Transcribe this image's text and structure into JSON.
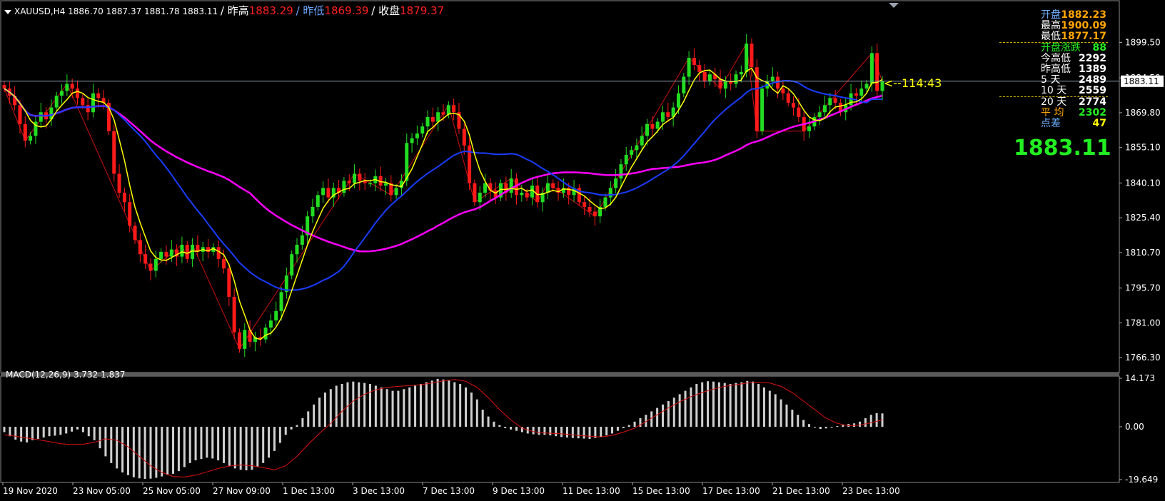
{
  "header": {
    "symbol": "XAUUSD,H4",
    "ohlc": "1886.70 1887.37 1881.78 1883.11",
    "label_high": "/ 昨高",
    "value_high": "1883.29",
    "label_low": "/ 昨低",
    "value_low": "1869.39",
    "label_close": "/ 收盘",
    "value_close": "1879.37"
  },
  "macd": {
    "label": "MACD(12,26,9) 3.732 1.837",
    "axis_labels": [
      "14.173",
      "0.00",
      "-19.649"
    ]
  },
  "price_axis": {
    "labels": [
      "1899.50",
      "1884.50",
      "1869.80",
      "1855.10",
      "1840.10",
      "1825.40",
      "1810.70",
      "1795.70",
      "1781.00",
      "1766.30"
    ],
    "current": "1883.11"
  },
  "time_axis": {
    "labels": [
      "19 Nov 2020",
      "23 Nov 05:00",
      "25 Nov 05:00",
      "27 Nov 09:00",
      "1 Dec 13:00",
      "3 Dec 13:00",
      "7 Dec 13:00",
      "9 Dec 13:00",
      "11 Dec 13:00",
      "15 Dec 13:00",
      "17 Dec 13:00",
      "21 Dec 13:00",
      "23 Dec 13:00"
    ]
  },
  "info_panel": {
    "rows": [
      {
        "k": "开盘",
        "v": "1882.23",
        "kc": "#6fb1ff",
        "vc": "#ffa500"
      },
      {
        "k": "最高",
        "v": "1900.09",
        "kc": "#ffffff",
        "vc": "#ffa500"
      },
      {
        "k": "最低",
        "v": "1877.17",
        "kc": "#ffffff",
        "vc": "#ffa500"
      },
      {
        "k": "开盘涨跌",
        "v": "88",
        "kc": "#22ee22",
        "vc": "#22ee22"
      },
      {
        "k": "今高低",
        "v": "2292",
        "kc": "#ffffff",
        "vc": "#ffffff"
      },
      {
        "k": "昨高低",
        "v": "1389",
        "kc": "#ffffff",
        "vc": "#ffffff"
      },
      {
        "k": "5  天",
        "v": "2489",
        "kc": "#ffffff",
        "vc": "#ffffff"
      },
      {
        "k": "10 天",
        "v": "2559",
        "kc": "#ffffff",
        "vc": "#ffffff"
      },
      {
        "k": "20 天",
        "v": "2774",
        "kc": "#ffffff",
        "vc": "#ffffff"
      },
      {
        "k": "平  均",
        "v": "2302",
        "kc": "#ffa500",
        "vc": "#22ee22"
      },
      {
        "k": "点差",
        "v": "47",
        "kc": "#6fb1ff",
        "vc": "#ffff00"
      }
    ],
    "big_price": "1883.11",
    "countdown": "<--114:43"
  },
  "colors": {
    "bull": "#22dd22",
    "bear": "#ff1a1a",
    "ma_fast": "#ffff00",
    "ma_mid": "#1a3cff",
    "ma_slow": "#ff00ff",
    "zigzag": "#cc1010",
    "grid": "#333333"
  },
  "chart_data": {
    "type": "candlestick",
    "title": "XAUUSD,H4",
    "ylim": [
      1760,
      1912
    ],
    "grid": false,
    "closes": [
      1880.0,
      1877.0,
      1873.0,
      1865.0,
      1858.0,
      1860.0,
      1866.0,
      1870.0,
      1867.0,
      1872.0,
      1877.0,
      1879.0,
      1882.0,
      1880.0,
      1876.0,
      1873.0,
      1870.0,
      1878.0,
      1876.0,
      1874.0,
      1862.0,
      1844.0,
      1836.0,
      1832.0,
      1822.0,
      1816.0,
      1810.0,
      1806.0,
      1803.0,
      1808.0,
      1811.0,
      1809.0,
      1812.0,
      1809.0,
      1814.0,
      1808.0,
      1814.0,
      1811.0,
      1813.0,
      1811.0,
      1813.0,
      1808.0,
      1804.0,
      1792.0,
      1777.0,
      1770.0,
      1778.0,
      1773.0,
      1775.0,
      1774.0,
      1779.0,
      1782.0,
      1786.0,
      1794.0,
      1801.0,
      1810.0,
      1814.0,
      1818.0,
      1826.0,
      1830.0,
      1835.0,
      1838.0,
      1834.0,
      1838.0,
      1836.0,
      1841.0,
      1840.0,
      1844.0,
      1841.0,
      1840.0,
      1840.0,
      1843.0,
      1839.0,
      1840.0,
      1835.0,
      1838.0,
      1841.0,
      1857.0,
      1859.0,
      1861.0,
      1864.0,
      1868.0,
      1866.0,
      1870.0,
      1869.0,
      1873.0,
      1870.0,
      1863.0,
      1856.0,
      1840.0,
      1832.0,
      1836.0,
      1840.0,
      1837.0,
      1834.0,
      1840.0,
      1836.0,
      1842.0,
      1835.0,
      1836.0,
      1834.0,
      1839.0,
      1832.0,
      1836.0,
      1840.0,
      1838.0,
      1836.0,
      1838.0,
      1835.0,
      1838.0,
      1832.0,
      1830.0,
      1828.0,
      1826.0,
      1830.0,
      1834.0,
      1838.0,
      1842.0,
      1848.0,
      1852.0,
      1854.0,
      1856.0,
      1860.0,
      1865.0,
      1863.0,
      1866.0,
      1870.0,
      1868.0,
      1872.0,
      1878.0,
      1885.0,
      1893.0,
      1890.0,
      1887.0,
      1883.0,
      1886.0,
      1884.0,
      1880.0,
      1883.0,
      1882.0,
      1886.0,
      1887.0,
      1899.0,
      1889.0,
      1862.0,
      1880.0,
      1883.0,
      1885.0,
      1880.0,
      1878.0,
      1874.0,
      1872.0,
      1868.0,
      1862.0,
      1864.0,
      1868.0,
      1870.0,
      1873.0,
      1876.0,
      1874.0,
      1870.0,
      1873.0,
      1878.0,
      1877.0,
      1880.0,
      1882.0,
      1895.0,
      1879.0,
      1883.11
    ],
    "series": [
      {
        "name": "MACD histogram",
        "values": [
          -2.0,
          -3.5,
          -4.8,
          -5.5,
          -5.8,
          -5.0,
          -4.5,
          -4.0,
          -3.5,
          -3.3,
          -3.0,
          -2.5,
          -1.8,
          -1.0,
          -2.0,
          -3.5,
          -5.0,
          -8.0,
          -11.0,
          -13.5,
          -15.5,
          -17.0,
          -18.0,
          -18.8,
          -19.2,
          -19.4,
          -19.3,
          -19.0,
          -18.5,
          -18.0,
          -17.5,
          -16.5,
          -15.0,
          -13.5,
          -12.5,
          -12.0,
          -11.5,
          -11.8,
          -12.5,
          -13.5,
          -14.5,
          -15.5,
          -16.0,
          -16.2,
          -16.0,
          -15.0,
          -13.5,
          -11.5,
          -9.0,
          -6.0,
          -3.0,
          -1.0,
          0.5,
          2.5,
          4.5,
          6.5,
          8.5,
          10.0,
          11.0,
          12.0,
          12.5,
          13.0,
          13.2,
          13.0,
          12.8,
          12.5,
          12.0,
          11.5,
          11.0,
          10.5,
          10.5,
          11.0,
          11.5,
          12.0,
          12.5,
          13.0,
          13.5,
          14.0,
          13.8,
          13.5,
          13.0,
          12.5,
          11.5,
          10.0,
          8.0,
          5.0,
          3.0,
          1.5,
          0.5,
          -0.5,
          -1.0,
          -1.5,
          -2.0,
          -2.5,
          -2.8,
          -3.0,
          -3.0,
          -3.2,
          -3.5,
          -3.8,
          -4.0,
          -4.2,
          -4.3,
          -4.4,
          -4.5,
          -4.2,
          -3.8,
          -3.2,
          -2.5,
          -1.5,
          -0.5,
          0.5,
          1.5,
          2.5,
          3.5,
          4.5,
          5.5,
          6.5,
          7.5,
          8.5,
          9.5,
          10.5,
          11.5,
          12.5,
          13.0,
          13.3,
          13.2,
          13.0,
          12.8,
          12.5,
          12.8,
          13.0,
          13.4,
          13.2,
          12.5,
          11.5,
          10.5,
          9.5,
          8.0,
          6.5,
          5.0,
          3.5,
          2.0,
          0.8,
          -0.3,
          -0.8,
          -0.6,
          -0.3,
          0.2,
          0.5,
          0.8,
          1.0,
          1.5,
          2.5,
          3.5,
          4.0,
          3.9
        ]
      },
      {
        "name": "MACD signal",
        "values": [
          -3.0,
          -3.5,
          -4.2,
          -4.8,
          -5.5,
          -6.3,
          -6.6,
          -6.5,
          -5.8,
          -4.5,
          -5.0,
          -7.5,
          -11.0,
          -14.5,
          -17.0,
          -18.5,
          -18.7,
          -18.0,
          -16.8,
          -15.5,
          -14.6,
          -14.2,
          -14.5,
          -15.2,
          -16.0,
          -14.5,
          -11.0,
          -6.5,
          -2.5,
          1.0,
          4.5,
          7.5,
          9.5,
          10.8,
          11.5,
          11.8,
          12.0,
          12.3,
          12.8,
          13.4,
          13.8,
          13.3,
          11.5,
          8.5,
          5.0,
          2.0,
          -0.5,
          -1.8,
          -2.3,
          -2.5,
          -2.8,
          -3.2,
          -3.5,
          -3.8,
          -3.2,
          -2.0,
          -0.5,
          1.5,
          3.5,
          5.5,
          7.3,
          8.8,
          10.0,
          11.0,
          11.8,
          12.3,
          12.8,
          13.0,
          12.8,
          11.8,
          10.0,
          7.5,
          5.0,
          2.5,
          1.0,
          0.3,
          0.5,
          1.2,
          2.0
        ]
      }
    ]
  }
}
